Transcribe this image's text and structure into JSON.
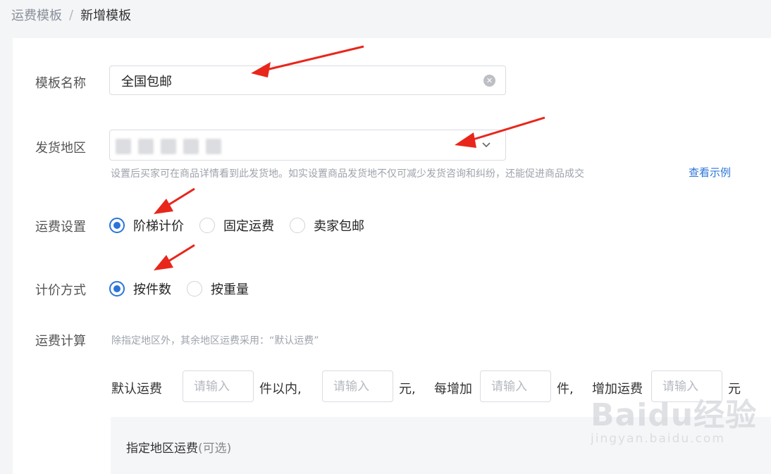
{
  "breadcrumb": {
    "parent": "运费模板",
    "separator": "/",
    "current": "新增模板"
  },
  "template_name": {
    "label": "模板名称",
    "value": "全国包邮",
    "clear_icon": "close-circle-icon"
  },
  "ship_region": {
    "label": "发货地区",
    "help": "设置后买家可在商品详情看到此发货地。如实设置商品发货地不仅可减少发货咨询和纠纷，还能促进商品成交",
    "help_link": "查看示例",
    "chevron_icon": "chevron-down-icon"
  },
  "freight_setting": {
    "label": "运费设置",
    "options": [
      {
        "label": "阶梯计价",
        "checked": true
      },
      {
        "label": "固定运费",
        "checked": false
      },
      {
        "label": "卖家包邮",
        "checked": false
      }
    ]
  },
  "pricing_method": {
    "label": "计价方式",
    "options": [
      {
        "label": "按件数",
        "checked": true
      },
      {
        "label": "按重量",
        "checked": false
      }
    ]
  },
  "freight_calc": {
    "label": "运费计算",
    "note": "除指定地区外，其余地区运费采用：“默认运费”",
    "default_fee_label": "默认运费",
    "within_label": "件以内,",
    "yuan1": "元,",
    "each_add_label": "每增加",
    "piece_label": "件,",
    "add_fee_label": "增加运费",
    "yuan2": "元",
    "placeholder": "请输入"
  },
  "region_fee": {
    "title": "指定地区运费",
    "optional": "(可选)"
  },
  "watermark": {
    "logo": "Baidu经验",
    "url": "jingyan.baidu.com"
  },
  "colors": {
    "accent": "#2a74d9",
    "arrow": "#e8261c",
    "background": "#f4f5f7"
  }
}
